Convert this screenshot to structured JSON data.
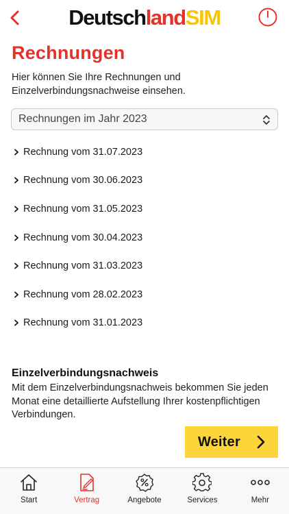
{
  "header": {
    "logo_part1": "Deutsch",
    "logo_part2": "land",
    "logo_part3": "SIM",
    "back_icon": "chevron-left-icon",
    "power_icon": "power-icon"
  },
  "page": {
    "title": "Rechnungen",
    "intro": "Hier können Sie Ihre Rechnungen und Einzelverbindungsnachweise einsehen."
  },
  "year_select": {
    "value": "Rechnungen im Jahr 2023"
  },
  "invoices": [
    {
      "label": "Rechnung vom 31.07.2023"
    },
    {
      "label": "Rechnung vom 30.06.2023"
    },
    {
      "label": "Rechnung vom 31.05.2023"
    },
    {
      "label": "Rechnung vom 30.04.2023"
    },
    {
      "label": "Rechnung vom 31.03.2023"
    },
    {
      "label": "Rechnung vom 28.02.2023"
    },
    {
      "label": "Rechnung vom 31.01.2023"
    }
  ],
  "evn": {
    "title": "Einzelverbindungsnachweis",
    "text": "Mit dem Einzelverbindungsnachweis bekommen Sie jeden Monat eine detaillierte Aufstellung Ihrer kostenpflichtigen Verbindungen.",
    "button_label": "Weiter"
  },
  "tabbar": {
    "tabs": [
      {
        "label": "Start",
        "icon": "home-icon"
      },
      {
        "label": "Vertrag",
        "icon": "contract-icon"
      },
      {
        "label": "Angebote",
        "icon": "percent-badge-icon"
      },
      {
        "label": "Services",
        "icon": "gear-icon"
      },
      {
        "label": "Mehr",
        "icon": "more-dots-icon"
      }
    ],
    "active_index": 1
  },
  "colors": {
    "brand_red": "#e4322b",
    "brand_yellow": "#fbd53a",
    "logo_yellow": "#f7c600"
  }
}
